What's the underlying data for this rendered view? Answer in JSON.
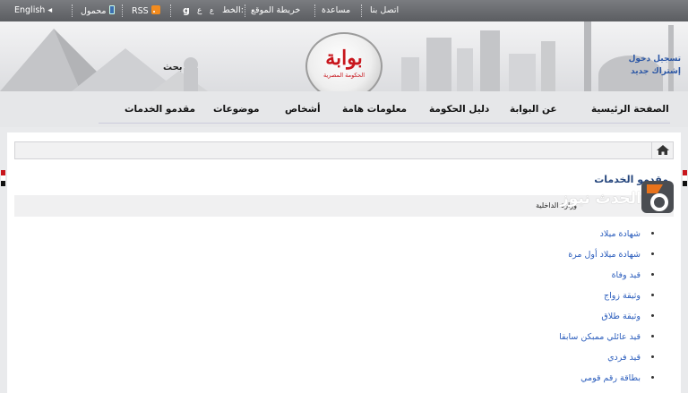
{
  "topbar": {
    "english": "English ◂",
    "mobile": "محمول",
    "rss": "RSS",
    "font_label": "الخط:",
    "font_small": "ع",
    "font_large": "ع",
    "sitemap": "خريطة الموقع",
    "help": "مساعدة",
    "contact": "اتصل بنا"
  },
  "header": {
    "logo_main": "بوابة",
    "logo_sub": "الحكومة المصرية",
    "search_label": "بحث",
    "login": "تسجيل دخول",
    "register": "إشتراك جديد"
  },
  "nav": {
    "items": [
      "الصفحة الرئيسية",
      "عن البوابة",
      "دليل الحكومة",
      "معلومات هامة",
      "أشخاص",
      "موضوعات",
      "مقدمو الخدمات"
    ]
  },
  "content": {
    "title": "مقدمو الخدمات",
    "subbar_text": "وزارة الداخلية",
    "watermark_text": "الحدث نيوز",
    "services": [
      "شهادة ميلاد",
      "شهادة ميلاد أول مرة",
      "قيد وفاة",
      "وثيقة زواج",
      "وثيقة طلاق",
      "قيد عائلي ممبكن سابقا",
      "قيد فردي",
      "بطاقة رقم قومي"
    ]
  },
  "colors": {
    "brand_red": "#c8161d",
    "link_blue": "#2c5ebd",
    "title_navy": "#25467d",
    "topbar_gray": "#666a6e"
  }
}
